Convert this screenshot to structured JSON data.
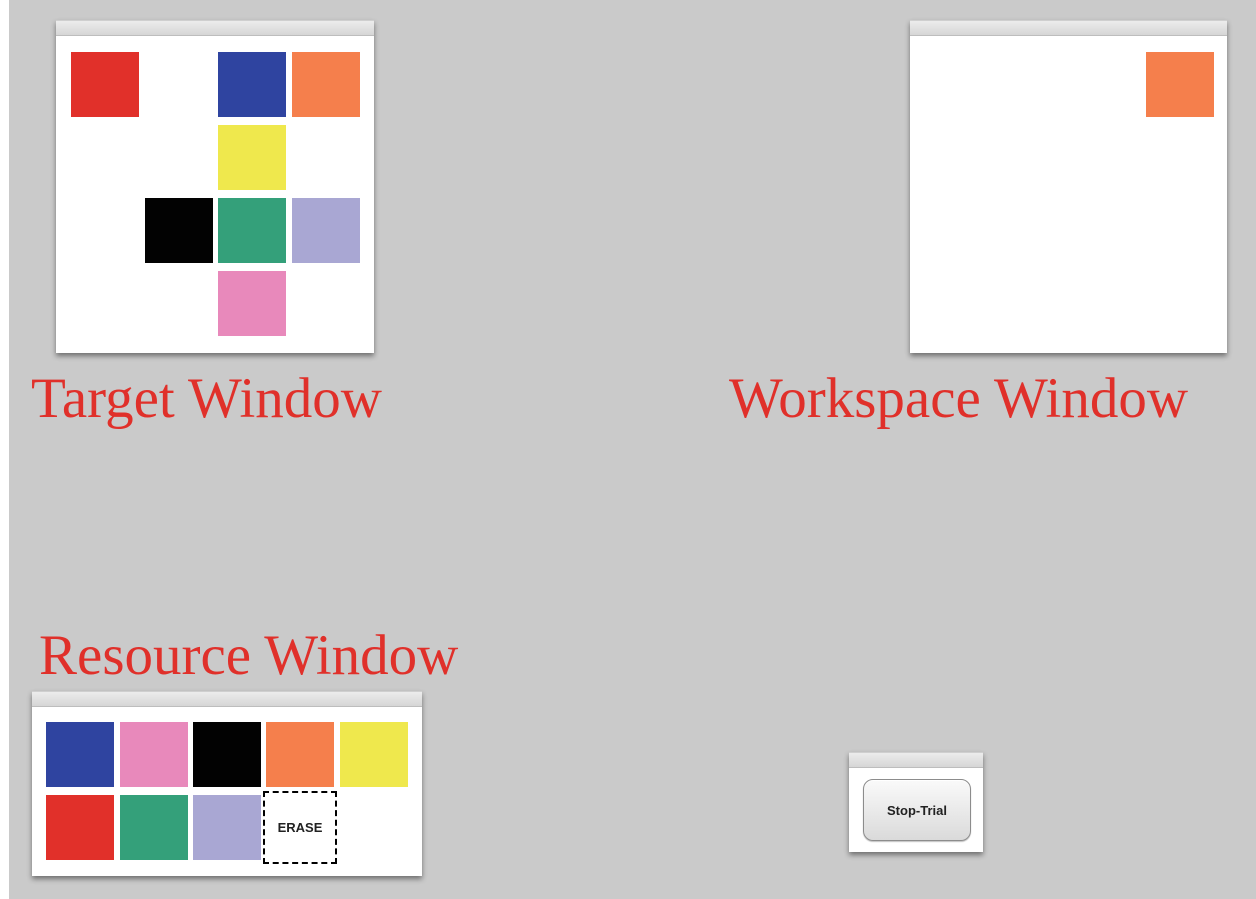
{
  "colors": {
    "red": "#e1302a",
    "blue": "#2f44a0",
    "orange": "#f57f4c",
    "yellow": "#efe84d",
    "black": "#020202",
    "green": "#34a07a",
    "lavender": "#a9a7d3",
    "pink": "#e889bb",
    "caption": "#e0302a",
    "desktop": "#cacaca"
  },
  "target_window": {
    "caption": "Target Window",
    "pattern": [
      {
        "color": "red"
      },
      {
        "color": "blue"
      },
      {
        "color": "orange"
      },
      {
        "color": "yellow"
      },
      {
        "color": "black"
      },
      {
        "color": "green"
      },
      {
        "color": "lavender"
      },
      {
        "color": "pink"
      }
    ]
  },
  "workspace_window": {
    "caption": "Workspace Window",
    "placed": [
      {
        "color": "orange"
      }
    ]
  },
  "resource_window": {
    "caption": "Resource Window",
    "palette": [
      {
        "color": "blue"
      },
      {
        "color": "pink"
      },
      {
        "color": "black"
      },
      {
        "color": "orange"
      },
      {
        "color": "yellow"
      },
      {
        "color": "red"
      },
      {
        "color": "green"
      },
      {
        "color": "lavender"
      }
    ],
    "erase_label": "ERASE"
  },
  "control_window": {
    "stop_label": "Stop-Trial"
  }
}
